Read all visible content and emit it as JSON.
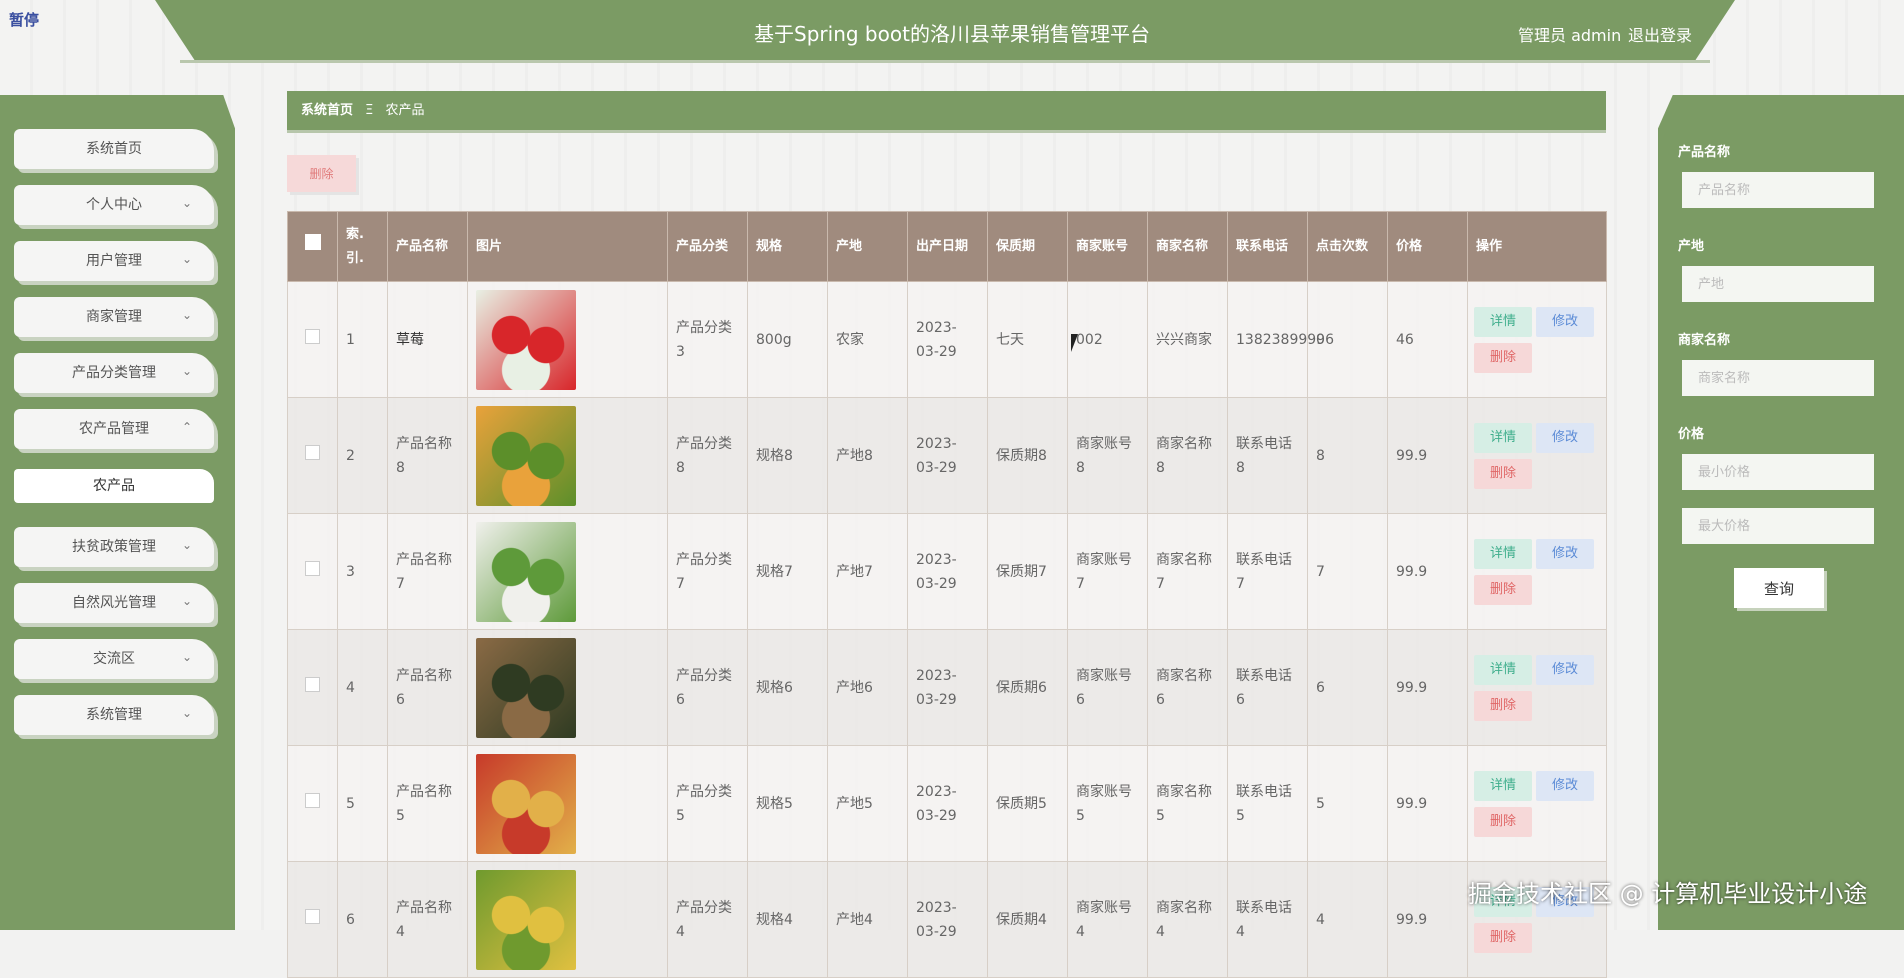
{
  "header": {
    "title": "基于Spring boot的洛川县苹果销售管理平台",
    "user": "管理员 admin",
    "logout": "退出登录",
    "pause_label": "暂停"
  },
  "sidebar": {
    "items": [
      {
        "label": "系统首页",
        "has_chevron": false
      },
      {
        "label": "个人中心",
        "has_chevron": true,
        "chevron": "⌄"
      },
      {
        "label": "用户管理",
        "has_chevron": true,
        "chevron": "⌄"
      },
      {
        "label": "商家管理",
        "has_chevron": true,
        "chevron": "⌄"
      },
      {
        "label": "产品分类管理",
        "has_chevron": true,
        "chevron": "⌄"
      },
      {
        "label": "农产品管理",
        "has_chevron": true,
        "chevron": "⌃"
      },
      {
        "label": "扶贫政策管理",
        "has_chevron": true,
        "chevron": "⌄"
      },
      {
        "label": "自然风光管理",
        "has_chevron": true,
        "chevron": "⌄"
      },
      {
        "label": "交流区",
        "has_chevron": true,
        "chevron": "⌄"
      },
      {
        "label": "系统管理",
        "has_chevron": true,
        "chevron": "⌄"
      }
    ],
    "sub_item": "农产品"
  },
  "breadcrumb": {
    "home": "系统首页",
    "sep": "Ξ",
    "current": "农产品"
  },
  "toolbar": {
    "delete_label": "删除"
  },
  "search": {
    "product_name_label": "产品名称",
    "product_name_placeholder": "产品名称",
    "origin_label": "产地",
    "origin_placeholder": "产地",
    "merchant_label": "商家名称",
    "merchant_placeholder": "商家名称",
    "price_label": "价格",
    "min_price_placeholder": "最小价格",
    "max_price_placeholder": "最大价格",
    "query_label": "查询"
  },
  "table": {
    "headers": [
      "索.引.",
      "产品名称",
      "图片",
      "产品分类",
      "规格",
      "产地",
      "出产日期",
      "保质期",
      "商家账号",
      "商家名称",
      "联系电话",
      "点击次数",
      "价格",
      "操作"
    ],
    "actions": {
      "detail": "详情",
      "edit": "修改",
      "delete": "删除"
    },
    "rows": [
      {
        "idx": "1",
        "name": "草莓",
        "category": "产品分类3",
        "spec": "800g",
        "origin": "农家",
        "date": "2023-03-29",
        "shelf": "七天",
        "account": "002",
        "merchant": "兴兴商家",
        "phone": "13823899996",
        "clicks": "0",
        "price": "46",
        "image": "strawberry-image",
        "c1": "#e8f0e4",
        "c2": "#d8262a"
      },
      {
        "idx": "2",
        "name": "产品名称8",
        "category": "产品分类8",
        "spec": "规格8",
        "origin": "产地8",
        "date": "2023-03-29",
        "shelf": "保质期8",
        "account": "商家账号8",
        "merchant": "商家名称8",
        "phone": "联系电话8",
        "clicks": "8",
        "price": "99.9",
        "image": "mixed-fruit-image",
        "c1": "#e9a23b",
        "c2": "#5c8f2a"
      },
      {
        "idx": "3",
        "name": "产品名称7",
        "category": "产品分类7",
        "spec": "规格7",
        "origin": "产地7",
        "date": "2023-03-29",
        "shelf": "保质期7",
        "account": "商家账号7",
        "merchant": "商家名称7",
        "phone": "联系电话7",
        "clicks": "7",
        "price": "99.9",
        "image": "vegetable-basket-image",
        "c1": "#f0f0ec",
        "c2": "#5e9a3a"
      },
      {
        "idx": "4",
        "name": "产品名称6",
        "category": "产品分类6",
        "spec": "规格6",
        "origin": "产地6",
        "date": "2023-03-29",
        "shelf": "保质期6",
        "account": "商家账号6",
        "merchant": "商家名称6",
        "phone": "联系电话6",
        "clicks": "6",
        "price": "99.9",
        "image": "avocado-image",
        "c1": "#8a6a45",
        "c2": "#2f3b22"
      },
      {
        "idx": "5",
        "name": "产品名称5",
        "category": "产品分类5",
        "spec": "规格5",
        "origin": "产地5",
        "date": "2023-03-29",
        "shelf": "保质期5",
        "account": "商家账号5",
        "merchant": "商家名称5",
        "phone": "联系电话5",
        "clicks": "5",
        "price": "99.9",
        "image": "fruit-pile-image",
        "c1": "#c73a2a",
        "c2": "#e2b049"
      },
      {
        "idx": "6",
        "name": "产品名称4",
        "category": "产品分类4",
        "spec": "规格4",
        "origin": "产地4",
        "date": "2023-03-29",
        "shelf": "保质期4",
        "account": "商家账号4",
        "merchant": "商家名称4",
        "phone": "联系电话4",
        "clicks": "4",
        "price": "99.9",
        "image": "green-fruit-image",
        "c1": "#6f9a2e",
        "c2": "#e0c040"
      }
    ]
  },
  "watermark": "掘金技术社区 @ 计算机毕业设计小途"
}
